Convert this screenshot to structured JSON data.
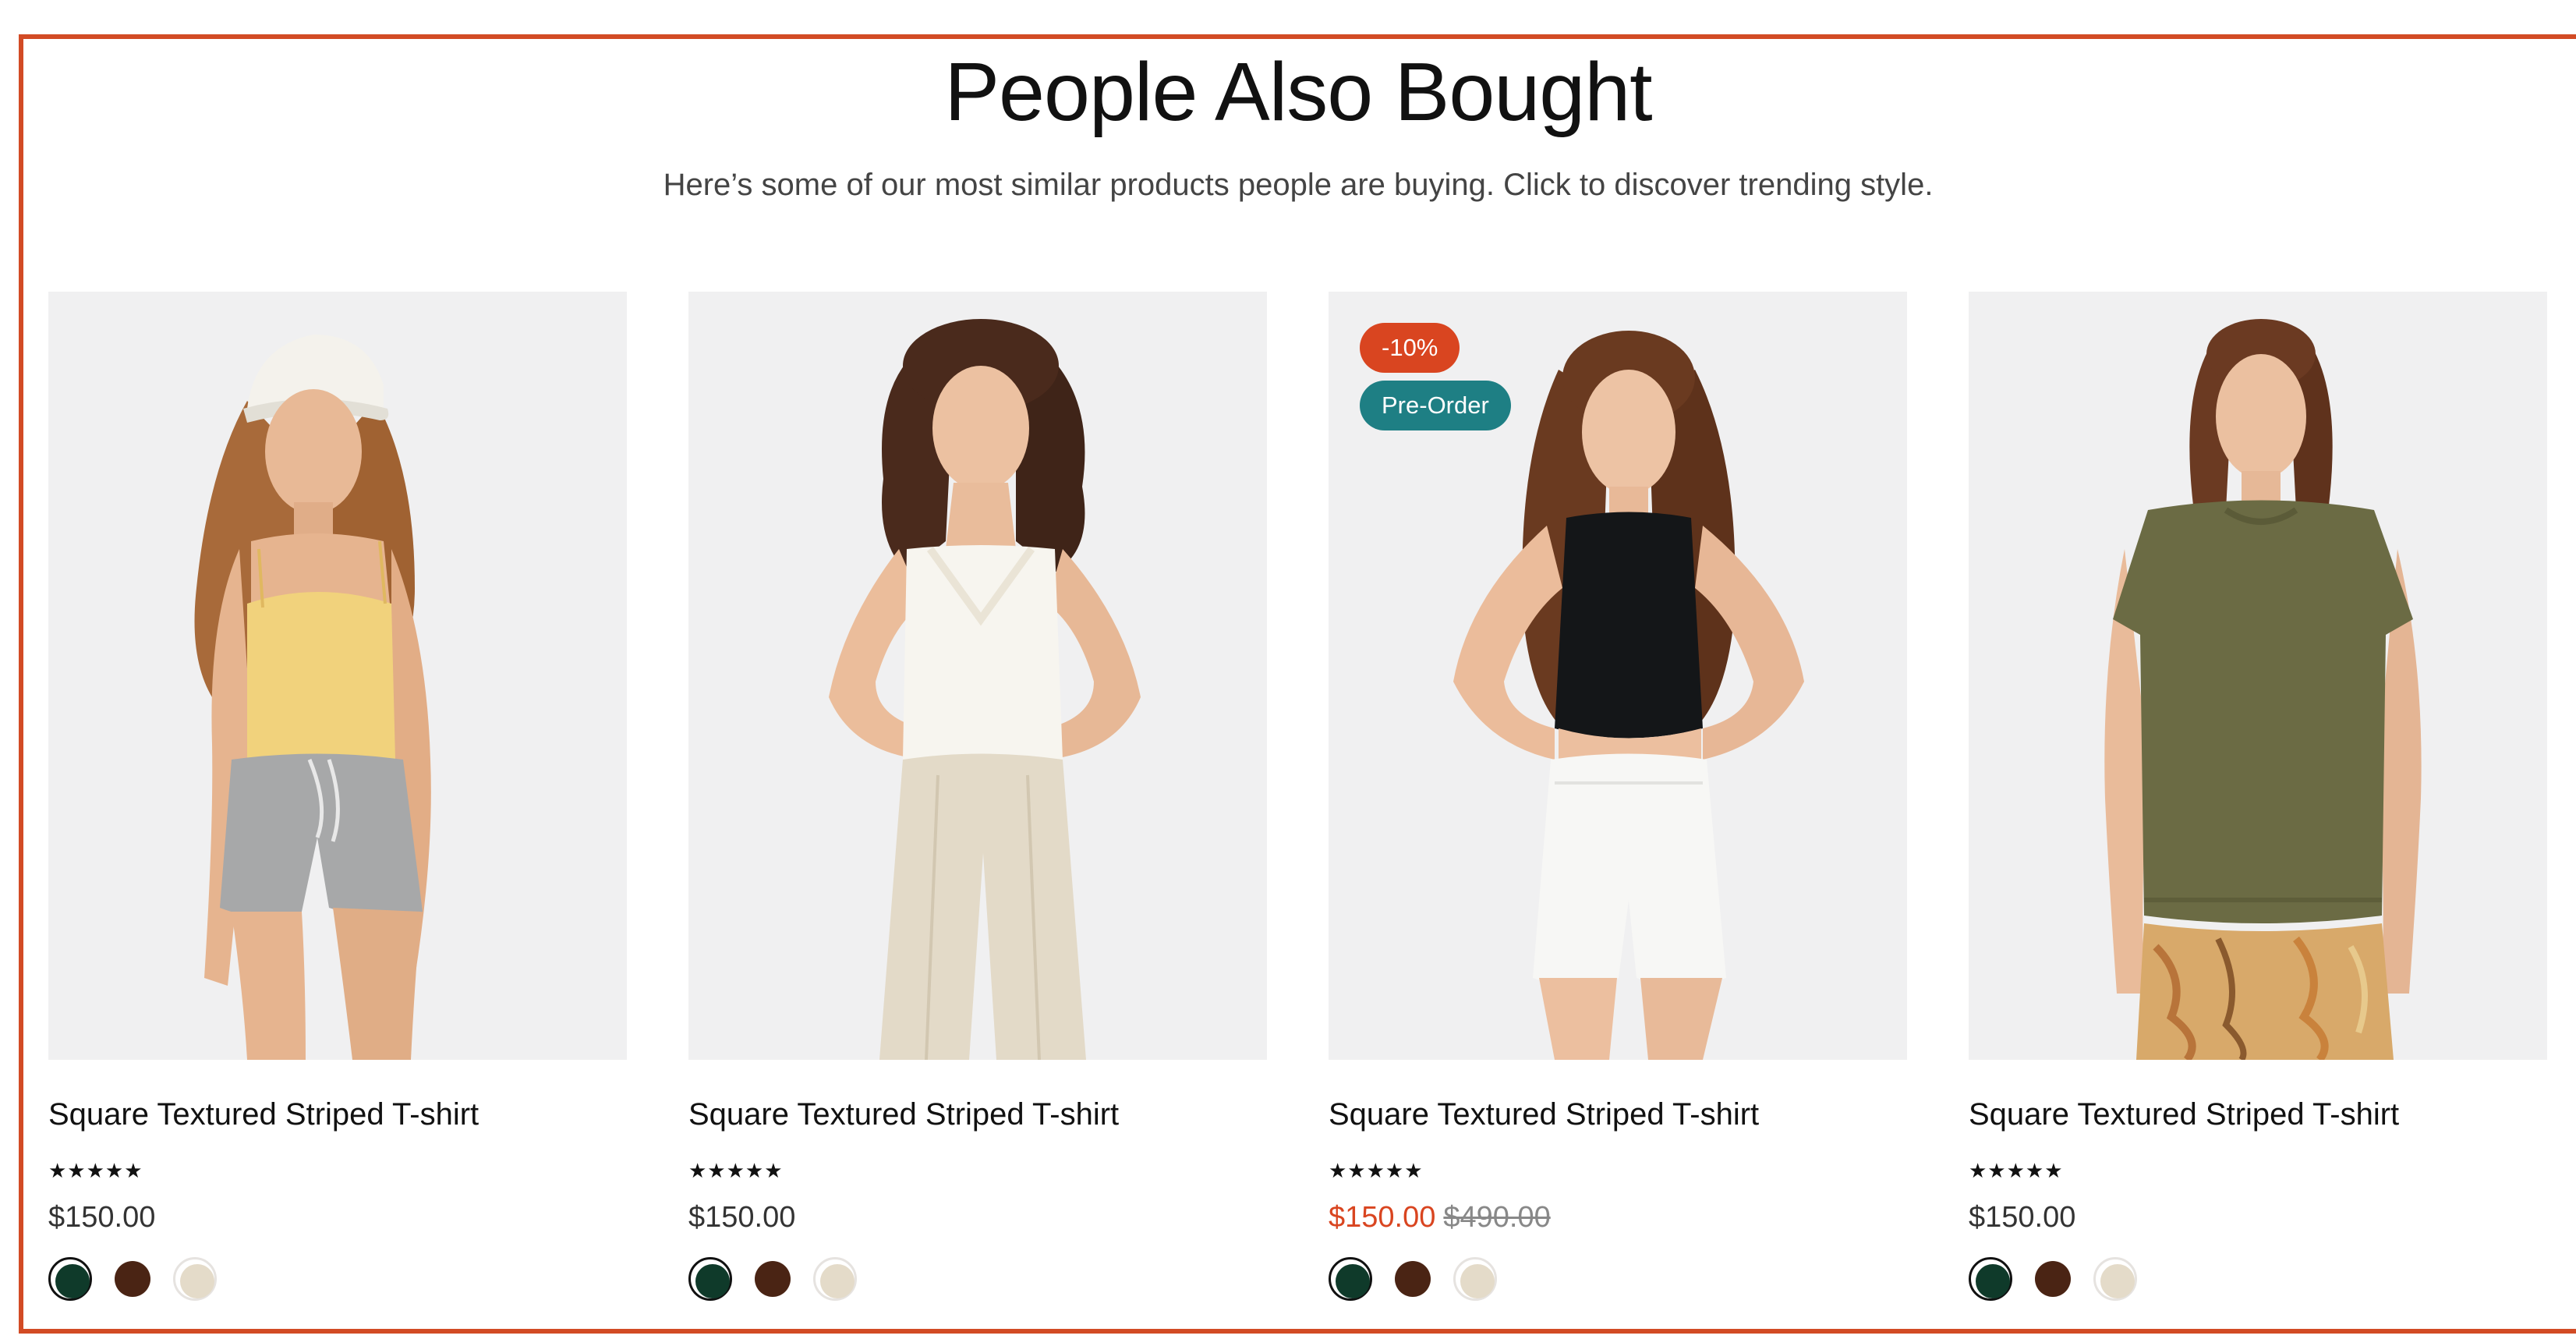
{
  "section": {
    "title": "People Also Bought",
    "subtitle": "Here’s some of our most similar products people are buying. Click to discover trending style."
  },
  "colors": {
    "frame_border": "#d24b25",
    "sale_badge": "#d94520",
    "preorder_badge": "#1e7f84",
    "sale_price": "#d94520",
    "image_background": "#f0f0f1",
    "swatch_green": "#0f3a2a",
    "swatch_brown": "#4a2414",
    "swatch_beige": "#e4dbc9"
  },
  "products": [
    {
      "name": "Square Textured Striped T-shirt",
      "rating_stars": "★★★★★",
      "price": "$150.00",
      "image_alt": "model in yellow cami, grey shorts and white cap",
      "swatches": [
        "dark-green",
        "brown",
        "beige"
      ]
    },
    {
      "name": "Square Textured Striped T-shirt",
      "rating_stars": "★★★★★",
      "price": "$150.00",
      "image_alt": "model in white lace cami and beige trousers",
      "swatches": [
        "dark-green",
        "brown",
        "beige"
      ]
    },
    {
      "name": "Square Textured Striped T-shirt",
      "rating_stars": "★★★★★",
      "price": "$150.00",
      "compare_price": "$490.00",
      "badges": {
        "sale": "-10%",
        "preorder": "Pre-Order"
      },
      "image_alt": "model in black crop top and white denim shorts",
      "swatches": [
        "dark-green",
        "brown",
        "beige"
      ]
    },
    {
      "name": "Square Textured Striped T-shirt",
      "rating_stars": "★★★★★",
      "price": "$150.00",
      "image_alt": "model in olive knit top and patterned trousers",
      "swatches": [
        "dark-green",
        "brown",
        "beige"
      ]
    }
  ]
}
